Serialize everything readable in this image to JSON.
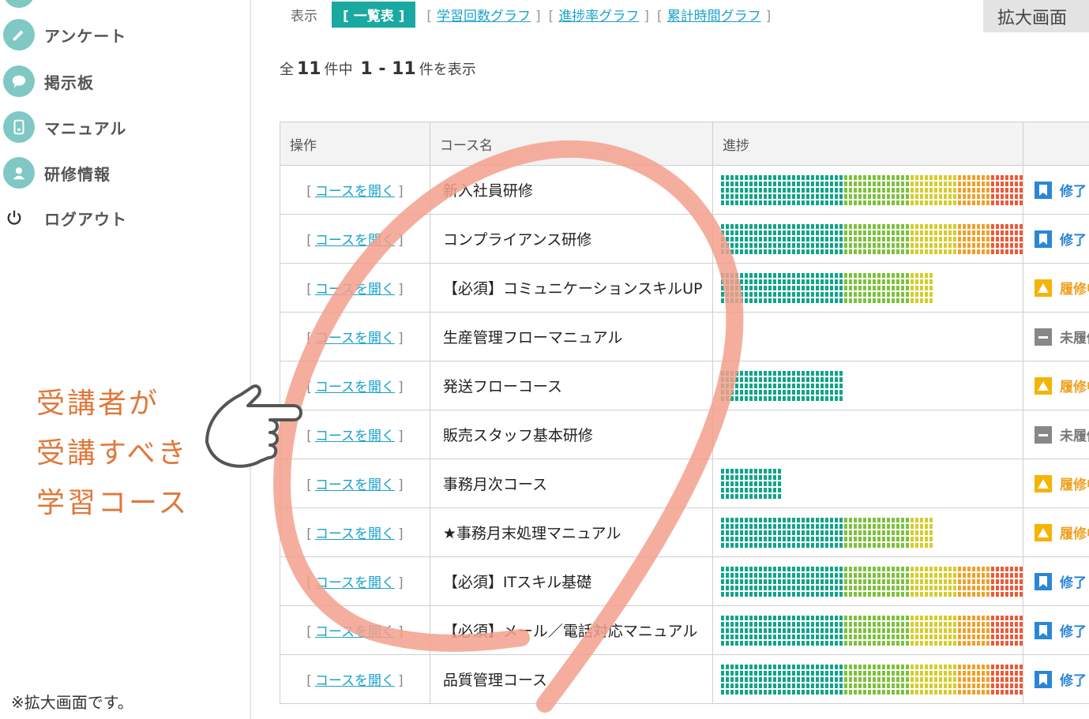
{
  "sidebar": {
    "items": [
      {
        "label": "アンケート",
        "icon": "pencil-icon"
      },
      {
        "label": "掲示板",
        "icon": "chat-bubble-icon"
      },
      {
        "label": "マニュアル",
        "icon": "tablet-icon"
      },
      {
        "label": "研修情報",
        "icon": "user-icon"
      },
      {
        "label": "ログアウト",
        "icon": "power-icon"
      }
    ]
  },
  "annotation": {
    "line1": "受講者が",
    "line2": "受講すべき",
    "line3": "学習コース",
    "color": "#e0783a"
  },
  "footnote": "※拡大画面です。",
  "view": {
    "label": "表示",
    "active": "[ 一覧表 ]",
    "links": [
      "学習回数グラフ",
      "進捗率グラフ",
      "累計時間グラフ"
    ]
  },
  "zoom_button": "拡大画面",
  "count": {
    "prefix": "全",
    "total": "11",
    "mid": "件中",
    "range": "1 - 11",
    "suffix": "件を表示"
  },
  "table": {
    "headers": [
      "操作",
      "コース名",
      "進捗"
    ],
    "open_label": "コースを開く",
    "rows": [
      {
        "name": "新入社員研修",
        "progress": 100,
        "status": "修了",
        "status_type": "done"
      },
      {
        "name": "コンプライアンス研修",
        "progress": 100,
        "status": "修了",
        "status_type": "done"
      },
      {
        "name": "【必須】コミュニケーションスキルUP",
        "progress": 70,
        "status": "履修中",
        "status_type": "mid"
      },
      {
        "name": "生産管理フローマニュアル",
        "progress": 0,
        "status": "未履修",
        "status_type": "none"
      },
      {
        "name": "発送フローコース",
        "progress": 40,
        "status": "履修中",
        "status_type": "mid"
      },
      {
        "name": "販売スタッフ基本研修",
        "progress": 0,
        "status": "未履修",
        "status_type": "none"
      },
      {
        "name": "事務月次コース",
        "progress": 20,
        "status": "履修中",
        "status_type": "mid"
      },
      {
        "name": "★事務月末処理マニュアル",
        "progress": 70,
        "status": "履修中",
        "status_type": "mid"
      },
      {
        "name": "【必須】ITスキル基礎",
        "progress": 100,
        "status": "修了",
        "status_type": "done"
      },
      {
        "name": "【必須】メール／電話対応マニュアル",
        "progress": 100,
        "status": "修了",
        "status_type": "done"
      },
      {
        "name": "品質管理コース",
        "progress": 100,
        "status": "修了",
        "status_type": "done"
      }
    ]
  },
  "colors": {
    "accent": "#19a9a0",
    "link": "#1aa2c9",
    "done": "#2a86d6",
    "in_progress": "#f0a020",
    "not_started": "#777777",
    "circle": "#f3a08c"
  }
}
